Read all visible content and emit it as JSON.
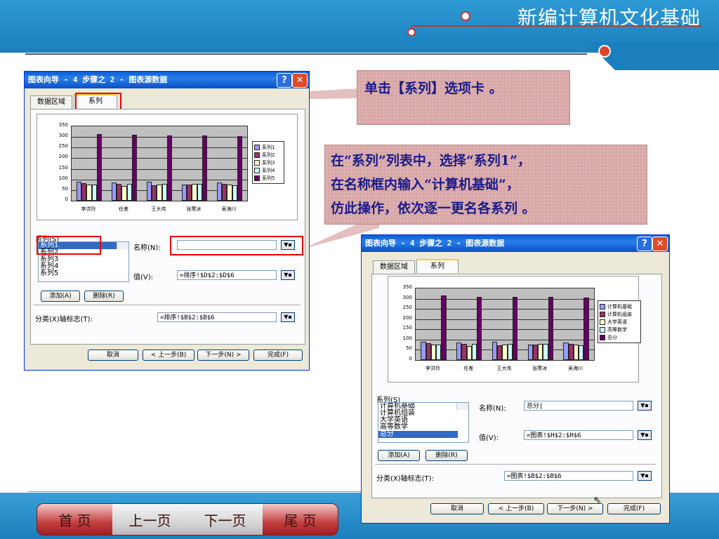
{
  "slide": {
    "title": "新编计算机文化基础",
    "nav": [
      "首 页",
      "上一页",
      "下一页",
      "尾 页"
    ]
  },
  "callouts": {
    "one": "单击【系列】选项卡 。",
    "two": [
      "在“系列”列表中，选择“系列1”，",
      "在名称框内输入“计算机基础”，",
      "仿此操作，依次逐一更名各系列 。"
    ]
  },
  "dialog_left": {
    "title": "图表向导 - 4 步骤之 2 - 图表源数据",
    "tabs": [
      "数据区域",
      "系列"
    ],
    "series_label": "系列(S)",
    "series_items": [
      "系列1",
      "系列2",
      "系列3",
      "系列4",
      "系列5"
    ],
    "name_label": "名称(N):",
    "name_value": "",
    "value_label": "值(V):",
    "value_value": "=排序!$D$2:$D$6",
    "add_btn": "添加(A)",
    "delete_btn": "删除(R)",
    "category_label": "分类(X)轴标志(T):",
    "category_value": "=排序!$B$2:$B$6",
    "buttons": [
      "取消",
      "< 上一步(B)",
      "下一步(N) >",
      "完成(F)"
    ]
  },
  "dialog_right": {
    "title": "图表向导 - 4 步骤之 2 - 图表源数据",
    "tabs": [
      "数据区域",
      "系列"
    ],
    "series_label": "系列(S)",
    "series_items": [
      "计算机基础",
      "计算机组装",
      "大学英语",
      "高等数学",
      "总分"
    ],
    "name_label": "名称(N):",
    "name_value": "总分|",
    "value_label": "值(V):",
    "value_value": "=图表!$H$2:$H$6",
    "add_btn": "添加(A)",
    "delete_btn": "删除(R)",
    "category_label": "分类(X)轴标志(T):",
    "category_value": "=图表!$B$2:$B$6",
    "buttons": [
      "取消",
      "< 上一步(B)",
      "下一步(N) >",
      "完成(F)"
    ]
  },
  "chart_data": [
    {
      "type": "bar",
      "categories": [
        "李洪玲",
        "任差",
        "王大伟",
        "张寒冰",
        "吴海川"
      ],
      "ylim": [
        0,
        350
      ],
      "yticks": [
        "350",
        "300",
        "250",
        "200",
        "150",
        "100",
        "50",
        "0"
      ],
      "series": [
        {
          "name": "系列1",
          "color": "#9999ff",
          "values": [
            90,
            85,
            90,
            75,
            85
          ]
        },
        {
          "name": "系列2",
          "color": "#993366",
          "values": [
            82,
            78,
            72,
            75,
            78
          ]
        },
        {
          "name": "系列3",
          "color": "#ffffcc",
          "values": [
            75,
            70,
            75,
            78,
            75
          ]
        },
        {
          "name": "系列4",
          "color": "#ccffff",
          "values": [
            75,
            80,
            78,
            80,
            72
          ]
        },
        {
          "name": "系列5",
          "color": "#660066",
          "values": [
            315,
            310,
            308,
            308,
            305
          ]
        }
      ]
    },
    {
      "type": "bar",
      "categories": [
        "李洪玲",
        "任差",
        "王大伟",
        "张寒冰",
        "吴海川"
      ],
      "ylim": [
        0,
        350
      ],
      "yticks": [
        "350",
        "300",
        "250",
        "200",
        "150",
        "100",
        "50",
        "0"
      ],
      "series": [
        {
          "name": "计算机基础",
          "color": "#9999ff",
          "values": [
            90,
            85,
            90,
            75,
            85
          ]
        },
        {
          "name": "计算机组装",
          "color": "#993366",
          "values": [
            82,
            78,
            72,
            75,
            78
          ]
        },
        {
          "name": "大学英语",
          "color": "#ffffcc",
          "values": [
            75,
            70,
            75,
            78,
            75
          ]
        },
        {
          "name": "高等数学",
          "color": "#ccffff",
          "values": [
            75,
            80,
            78,
            80,
            72
          ]
        },
        {
          "name": "总分",
          "color": "#660066",
          "values": [
            315,
            310,
            308,
            308,
            305
          ]
        }
      ]
    }
  ]
}
